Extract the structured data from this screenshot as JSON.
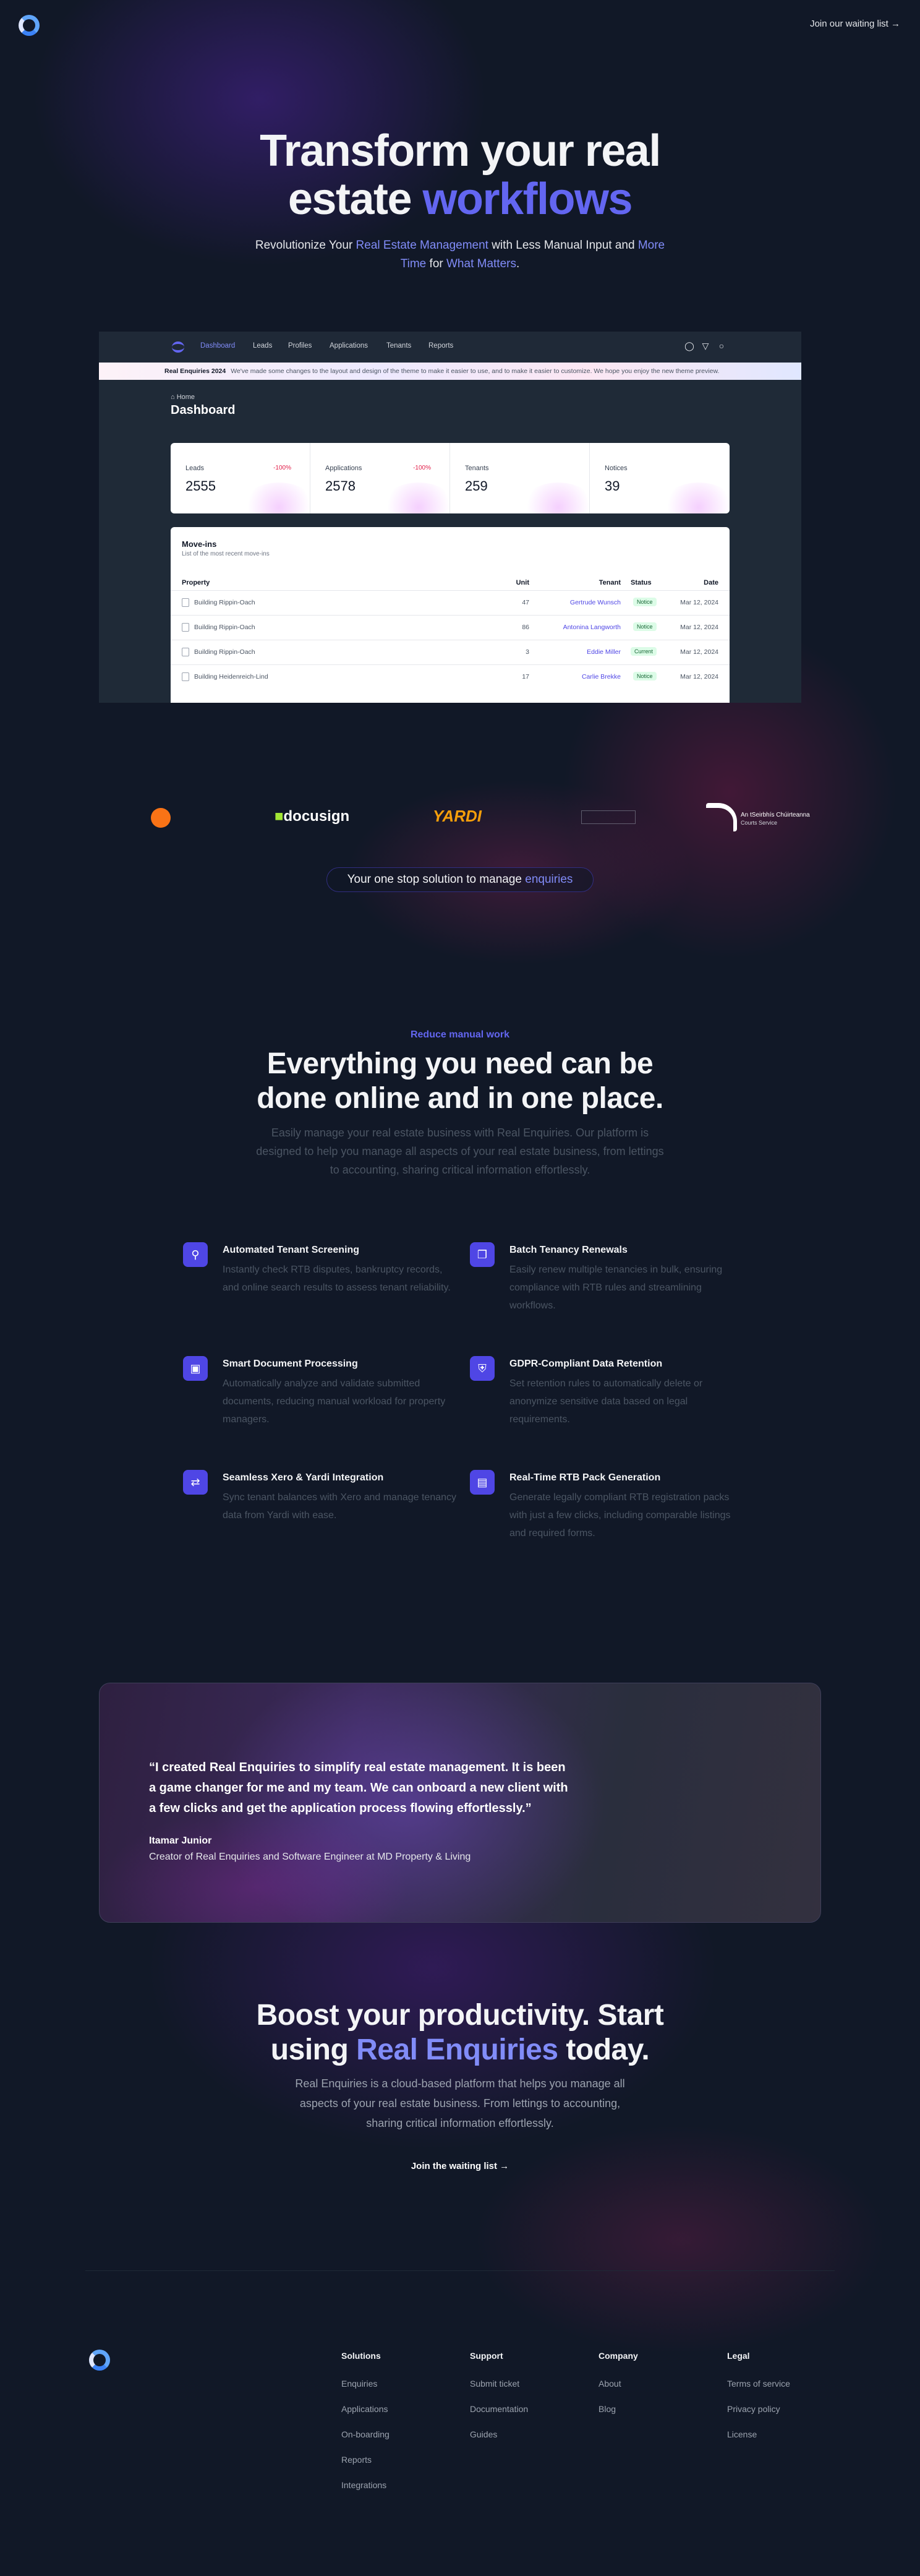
{
  "header": {
    "join_link": "Join our waiting list →"
  },
  "hero": {
    "title_line1": "Transform your real",
    "title_line2_a": "estate ",
    "title_line2_b": "workflows",
    "sub_1": "Revolutionize Your ",
    "sub_2": "Real Estate Management",
    "sub_3": " with Less Manual Input and ",
    "sub_4": "More Time",
    "sub_5": " for ",
    "sub_6": "What Matters",
    "sub_7": "."
  },
  "dashboard": {
    "nav": [
      "Dashboard",
      "Leads",
      "Profiles",
      "Applications",
      "Tenants",
      "Reports"
    ],
    "banner_title": "Real Enquiries 2024",
    "banner_text": "We've made some changes to the layout and design of the theme to make it easier to use, and to make it easier to customize. We hope you enjoy the new theme preview.",
    "breadcrumb": "Home",
    "title": "Dashboard",
    "stats": [
      {
        "label": "Leads",
        "value": "2555",
        "change": "-100%"
      },
      {
        "label": "Applications",
        "value": "2578",
        "change": "-100%"
      },
      {
        "label": "Tenants",
        "value": "259",
        "change": ""
      },
      {
        "label": "Notices",
        "value": "39",
        "change": ""
      }
    ],
    "movein_title": "Move-ins",
    "movein_sub": "List of the most recent move-ins",
    "columns": [
      "Property",
      "Unit",
      "Tenant",
      "Status",
      "Date"
    ],
    "rows": [
      {
        "property": "Building Rippin-Oach",
        "unit": "47",
        "tenant": "Gertrude Wunsch",
        "status": "Notice",
        "date": "Mar 12, 2024"
      },
      {
        "property": "Building Rippin-Oach",
        "unit": "86",
        "tenant": "Antonina Langworth",
        "status": "Notice",
        "date": "Mar 12, 2024"
      },
      {
        "property": "Building Rippin-Oach",
        "unit": "3",
        "tenant": "Eddie Miller",
        "status": "Current",
        "date": "Mar 12, 2024"
      },
      {
        "property": "Building Heidenreich-Lind",
        "unit": "17",
        "tenant": "Carlie Brekke",
        "status": "Notice",
        "date": "Mar 12, 2024"
      }
    ]
  },
  "logos": {
    "docusign": "docusign",
    "yardi": "YARDI",
    "gov_line1": "An tSeirbhís Chúirteanna",
    "gov_line2": "Courts Service"
  },
  "tagline": {
    "text": "Your one stop solution to manage ",
    "highlight": "enquiries"
  },
  "features_section": {
    "eyebrow": "Reduce manual work",
    "title_line1": "Everything you need can be",
    "title_line2": "done online and in one place.",
    "subtitle": "Easily manage your real estate business with Real Enquiries. Our platform is designed to help you manage all aspects of your real estate business, from lettings to accounting, sharing critical information effortlessly.",
    "items": [
      {
        "title": "Automated Tenant Screening",
        "desc": "Instantly check RTB disputes, bankruptcy records, and online search results to assess tenant reliability."
      },
      {
        "title": "Batch Tenancy Renewals",
        "desc": "Easily renew multiple tenancies in bulk, ensuring compliance with RTB rules and streamlining workflows."
      },
      {
        "title": "Smart Document Processing",
        "desc": "Automatically analyze and validate submitted documents, reducing manual workload for property managers."
      },
      {
        "title": "GDPR-Compliant Data Retention",
        "desc": "Set retention rules to automatically delete or anonymize sensitive data based on legal requirements."
      },
      {
        "title": "Seamless Xero & Yardi Integration",
        "desc": "Sync tenant balances with Xero and manage tenancy data from Yardi with ease."
      },
      {
        "title": "Real-Time RTB Pack Generation",
        "desc": "Generate legally compliant RTB registration packs with just a few clicks, including comparable listings and required forms."
      }
    ]
  },
  "testimonial": {
    "quote": "“I created Real Enquiries to simplify real estate management. It is been a game changer for me and my team. We can onboard a new client with a few clicks and get the application process flowing effortlessly.”",
    "name": "Itamar Junior",
    "role": "Creator of Real Enquiries and Software Engineer at MD Property & Living"
  },
  "cta": {
    "title_line1": "Boost your productivity. Start",
    "title_line2_a": "using ",
    "title_line2_b": "Real Enquiries",
    "title_line2_c": " today.",
    "subtitle": "Real Enquiries is a cloud-based platform that helps you manage all aspects of your real estate business. From lettings to accounting, sharing critical information effortlessly.",
    "button": "Join the waiting list →"
  },
  "footer": {
    "columns": [
      {
        "heading": "Solutions",
        "links": [
          "Enquiries",
          "Applications",
          "On-boarding",
          "Reports",
          "Integrations"
        ]
      },
      {
        "heading": "Support",
        "links": [
          "Submit ticket",
          "Documentation",
          "Guides"
        ]
      },
      {
        "heading": "Company",
        "links": [
          "About",
          "Blog"
        ]
      },
      {
        "heading": "Legal",
        "links": [
          "Terms of service",
          "Privacy policy",
          "License"
        ]
      }
    ]
  },
  "icons": [
    "logo-icon",
    "bell-icon",
    "filter-icon",
    "user-icon",
    "home-icon",
    "search-icon",
    "copy-icon",
    "document-icon",
    "shield-icon",
    "swap-icon",
    "file-icon"
  ],
  "colors": {
    "background": "#111827",
    "accent": "#6366f1",
    "accent_light": "#818cf8"
  }
}
